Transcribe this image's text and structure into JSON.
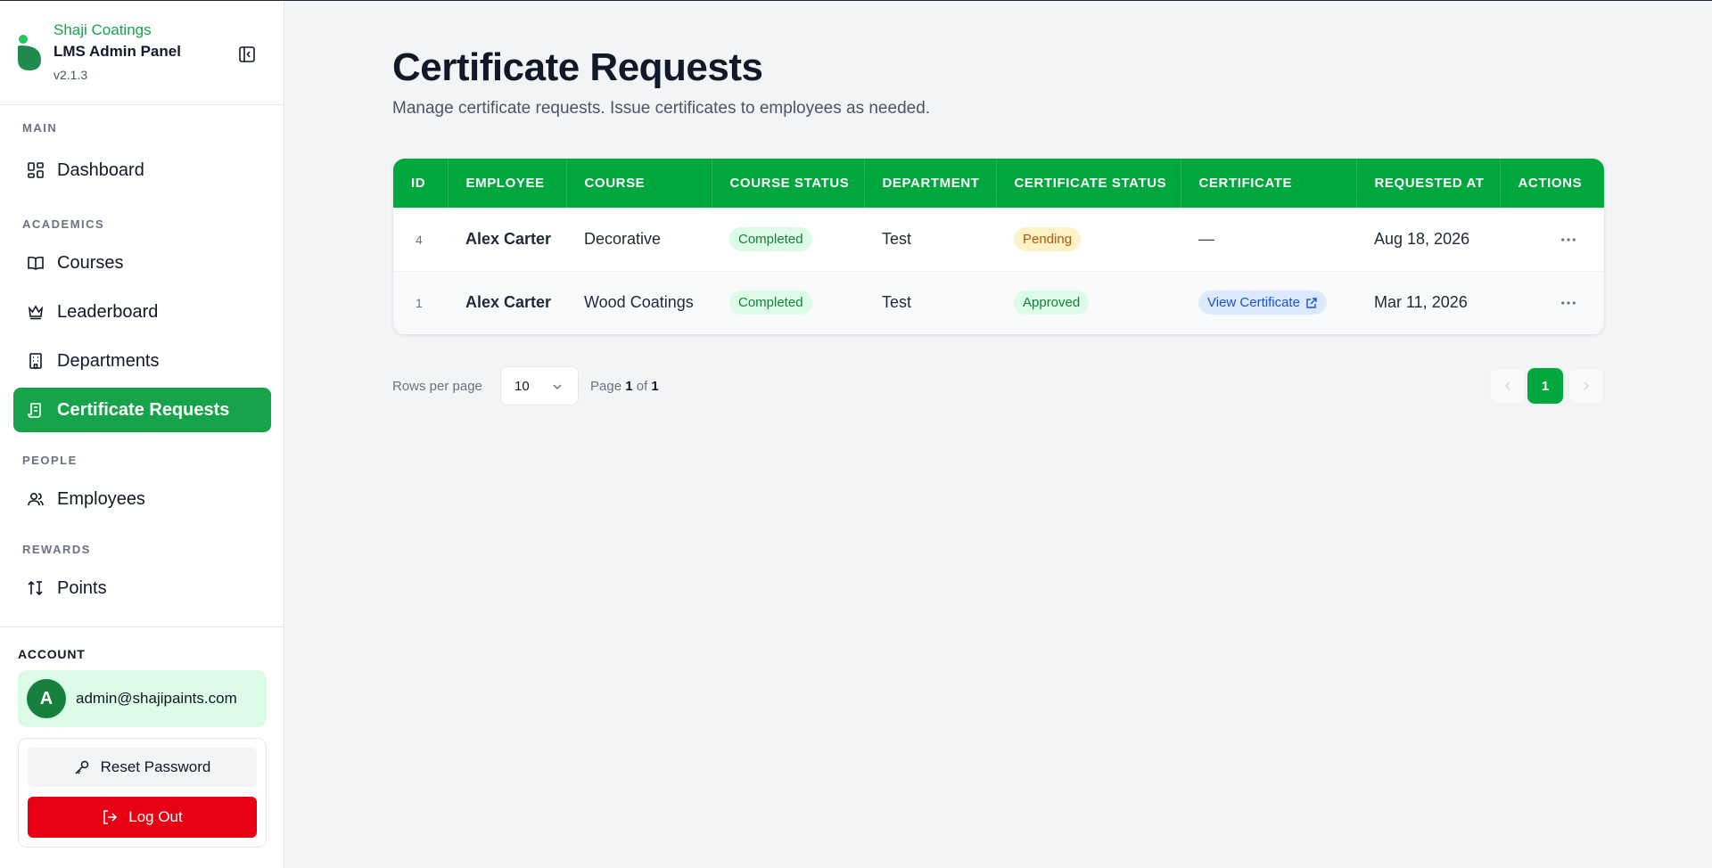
{
  "brand": {
    "company": "Shaji Coatings",
    "panel": "LMS Admin Panel",
    "version": "v2.1.3",
    "accent": "#16a34a"
  },
  "nav": {
    "sections": {
      "main": "MAIN",
      "academics": "ACADEMICS",
      "people": "PEOPLE",
      "rewards": "REWARDS"
    },
    "items": {
      "dashboard": {
        "label": "Dashboard",
        "icon": "dashboard-icon"
      },
      "courses": {
        "label": "Courses",
        "icon": "book-icon"
      },
      "leaderboard": {
        "label": "Leaderboard",
        "icon": "crown-icon"
      },
      "departments": {
        "label": "Departments",
        "icon": "building-icon"
      },
      "certificates": {
        "label": "Certificate Requests",
        "icon": "scroll-icon",
        "active": true
      },
      "employees": {
        "label": "Employees",
        "icon": "users-icon"
      },
      "points": {
        "label": "Points",
        "icon": "sort-arrows-icon"
      }
    }
  },
  "account": {
    "label": "ACCOUNT",
    "avatar_letter": "A",
    "email": "admin@shajipaints.com",
    "reset_label": "Reset Password",
    "logout_label": "Log Out",
    "logout_color": "#e60012"
  },
  "page": {
    "title": "Certificate Requests",
    "subtitle": "Manage certificate requests. Issue certificates to employees as needed."
  },
  "table": {
    "header_color": "#00a63e",
    "columns": {
      "id": "ID",
      "employee": "EMPLOYEE",
      "course": "COURSE",
      "course_status": "COURSE STATUS",
      "department": "DEPARTMENT",
      "certificate_status": "CERTIFICATE STATUS",
      "certificate": "CERTIFICATE",
      "requested_at": "REQUESTED AT",
      "actions": "ACTIONS"
    },
    "rows": [
      {
        "id": "4",
        "employee": "Alex Carter",
        "course": "Decorative",
        "course_status": "Completed",
        "department": "Test",
        "certificate_status": "Pending",
        "certificate": "—",
        "requested_at": "Aug 18, 2026"
      },
      {
        "id": "1",
        "employee": "Alex Carter",
        "course": "Wood Coatings",
        "course_status": "Completed",
        "department": "Test",
        "certificate_status": "Approved",
        "certificate": "View Certificate",
        "requested_at": "Mar 11, 2026"
      }
    ]
  },
  "pagination": {
    "rows_label": "Rows per page",
    "rows_value": "10",
    "page_word": "Page",
    "of_word": "of",
    "current_page": "1",
    "total_pages": "1"
  }
}
